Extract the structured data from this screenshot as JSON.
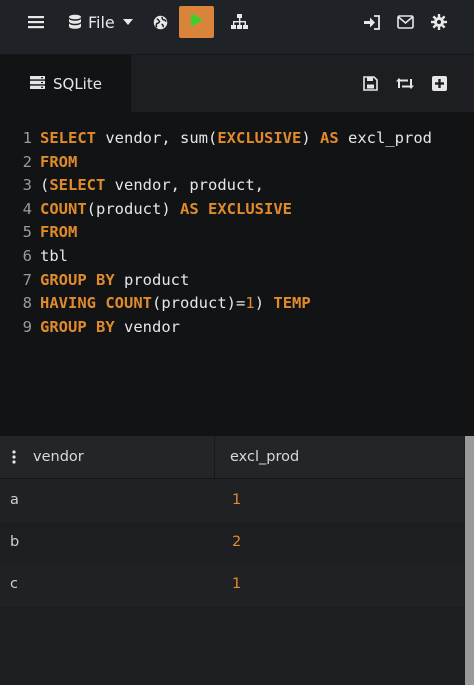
{
  "toolbar": {
    "file_label": "File"
  },
  "tab": {
    "label": "SQLite"
  },
  "editor": {
    "lines": [
      {
        "num": "1",
        "parts": [
          [
            "kw",
            "SELECT"
          ],
          [
            "t",
            " vendor, sum("
          ],
          [
            "kw",
            "EXCLUSIVE"
          ],
          [
            "t",
            ") "
          ],
          [
            "kw",
            "AS"
          ],
          [
            "t",
            " excl_prod"
          ]
        ]
      },
      {
        "num": "2",
        "parts": [
          [
            "kw",
            "FROM"
          ]
        ]
      },
      {
        "num": "3",
        "parts": [
          [
            "t",
            "("
          ],
          [
            "kw",
            "SELECT"
          ],
          [
            "t",
            " vendor, product,"
          ]
        ]
      },
      {
        "num": "4",
        "parts": [
          [
            "kw",
            "COUNT"
          ],
          [
            "t",
            "(product) "
          ],
          [
            "kw",
            "AS"
          ],
          [
            "t",
            " "
          ],
          [
            "kw",
            "EXCLUSIVE"
          ]
        ]
      },
      {
        "num": "5",
        "parts": [
          [
            "kw",
            "FROM"
          ]
        ]
      },
      {
        "num": "6",
        "parts": [
          [
            "t",
            "tbl"
          ]
        ]
      },
      {
        "num": "7",
        "parts": [
          [
            "kw",
            "GROUP"
          ],
          [
            "t",
            " "
          ],
          [
            "kw",
            "BY"
          ],
          [
            "t",
            " product"
          ]
        ]
      },
      {
        "num": "8",
        "parts": [
          [
            "kw",
            "HAVING"
          ],
          [
            "t",
            " "
          ],
          [
            "kw",
            "COUNT"
          ],
          [
            "t",
            "(product)="
          ],
          [
            "num",
            "1"
          ],
          [
            "t",
            ") "
          ],
          [
            "kw",
            "TEMP"
          ]
        ]
      },
      {
        "num": "9",
        "parts": [
          [
            "kw",
            "GROUP"
          ],
          [
            "t",
            " "
          ],
          [
            "kw",
            "BY"
          ],
          [
            "t",
            " vendor"
          ]
        ]
      }
    ]
  },
  "results": {
    "columns": [
      "vendor",
      "excl_prod"
    ],
    "rows": [
      {
        "vendor": "a",
        "excl_prod": "1"
      },
      {
        "vendor": "b",
        "excl_prod": "2"
      },
      {
        "vendor": "c",
        "excl_prod": "1"
      }
    ]
  },
  "colors": {
    "accent": "#d9843a",
    "keyword": "#e08a2c",
    "editor_bg": "#111315",
    "toolbar_bg": "#1f2226"
  },
  "icons": {
    "menu": "hamburger-icon",
    "file": "database-icon",
    "dropdown": "caret-down-icon",
    "globe": "globe-icon",
    "run": "play-icon",
    "schema": "sitemap-icon",
    "login": "sign-in-icon",
    "mail": "envelope-icon",
    "settings": "gear-icon",
    "save": "save-icon",
    "refresh": "retweet-icon",
    "add": "plus-square-icon",
    "options": "vertical-dots-icon"
  }
}
